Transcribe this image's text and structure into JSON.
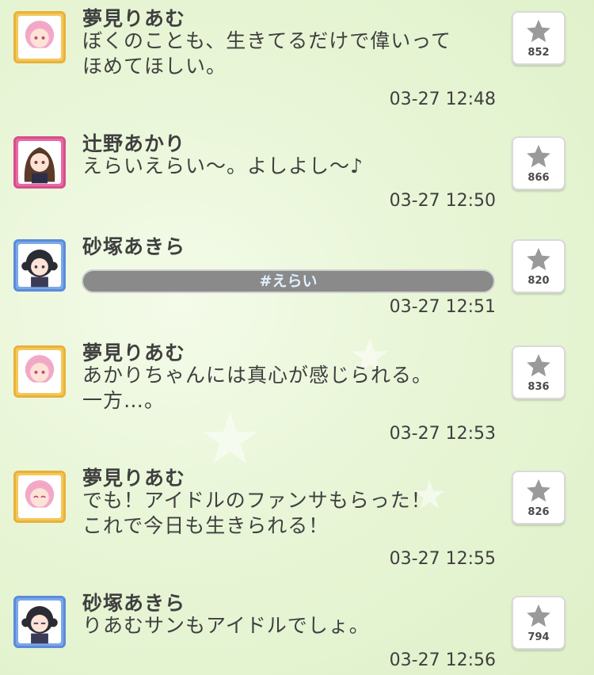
{
  "posts": [
    {
      "name": "夢見りあむ",
      "avatar": "riamu-avatar",
      "message": "ぼくのことも、生きてるだけで偉いって\nほめてほしい。",
      "time": "03-27 12:48",
      "likes": "852"
    },
    {
      "name": "辻野あかり",
      "avatar": "akari-avatar",
      "message": "えらいえらい〜。よしよし〜♪",
      "time": "03-27 12:50",
      "likes": "866"
    },
    {
      "name": "砂塚あきら",
      "avatar": "akira-avatar",
      "tag": "#えらい",
      "time": "03-27 12:51",
      "likes": "820"
    },
    {
      "name": "夢見りあむ",
      "avatar": "riamu-avatar",
      "message": "あかりちゃんには真心が感じられる。\n一方…。",
      "time": "03-27 12:53",
      "likes": "836"
    },
    {
      "name": "夢見りあむ",
      "avatar": "riamu-avatar",
      "message": "でも！アイドルのファンサもらった！\nこれで今日も生きられる！",
      "time": "03-27 12:55",
      "likes": "826"
    },
    {
      "name": "砂塚あきら",
      "avatar": "akira-avatar",
      "message": "りあむサンもアイドルでしょ。",
      "time": "03-27 12:56",
      "likes": "794"
    }
  ],
  "colors": {
    "text": "#3f3f3f",
    "star": "#9a9a9a",
    "tag_text": "#dff0ff"
  }
}
